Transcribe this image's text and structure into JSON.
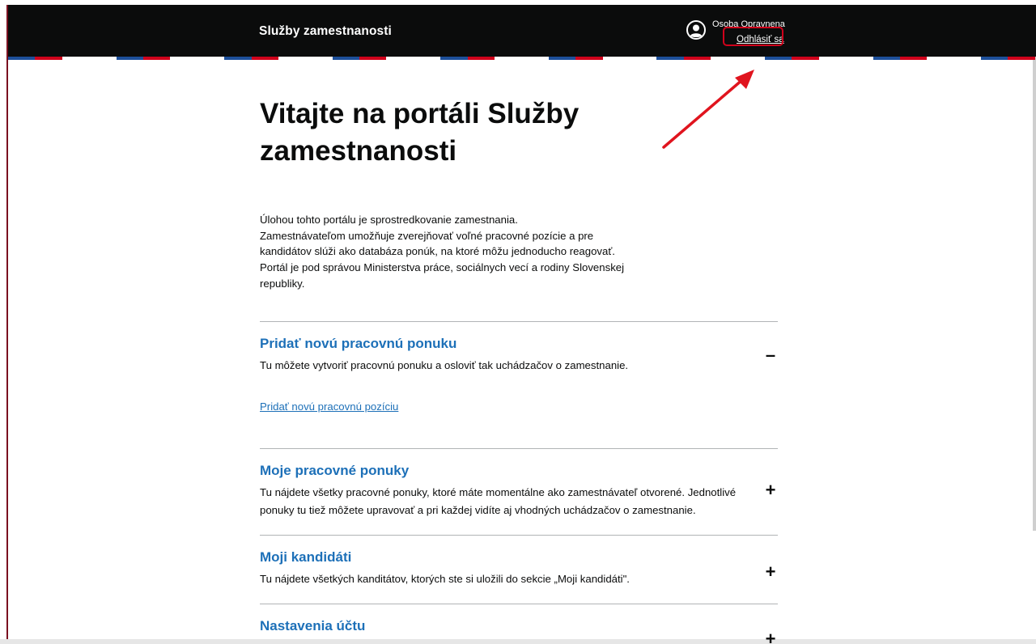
{
  "header": {
    "title": "Služby zamestnanosti",
    "user_name": "Osoba Opravnena",
    "logout_label": "Odhlásiť sa"
  },
  "main": {
    "title": "Vitajte na portáli Služby zamestnanosti",
    "intro_lines": [
      "Úlohou tohto portálu je sprostredkovanie zamestnania.",
      "Zamestnávateľom umožňuje zverejňovať voľné pracovné pozície a pre",
      "kandidátov slúži ako databáza ponúk, na ktoré môžu jednoducho reagovať.",
      "Portál je pod správou Ministerstva práce, sociálnych vecí a rodiny Slovenskej",
      "republiky."
    ],
    "sections": [
      {
        "heading": "Pridať novú pracovnú ponuku",
        "description": "Tu môžete vytvoriť pracovnú ponuku a osloviť tak uchádzačov o zamestnanie.",
        "link": "Pridať novú pracovnú pozíciu",
        "toggle": "–"
      },
      {
        "heading": "Moje pracovné ponuky",
        "description": "Tu nájdete všetky pracovné ponuky, ktoré máte momentálne ako zamestnávateľ otvorené. Jednotlivé ponuky tu tiež môžete upravovať a pri každej vidíte aj vhodných uchádzačov o zamestnanie.",
        "toggle": "+"
      },
      {
        "heading": "Moji kandidáti",
        "description": "Tu nájdete všetkých kanditátov, ktorých ste si uložili do sekcie „Moji kandidáti\".",
        "toggle": "+"
      },
      {
        "heading": "Nastavenia účtu",
        "toggle": "+"
      }
    ]
  },
  "colors": {
    "header_bg": "#0b0c0c",
    "link_blue": "#1d70b8",
    "highlight_red": "#d0021b",
    "stripe_blue": "#1d4f9a"
  },
  "icons": {
    "avatar": "user-circle-icon",
    "annotation": "red-arrow-annotation"
  }
}
